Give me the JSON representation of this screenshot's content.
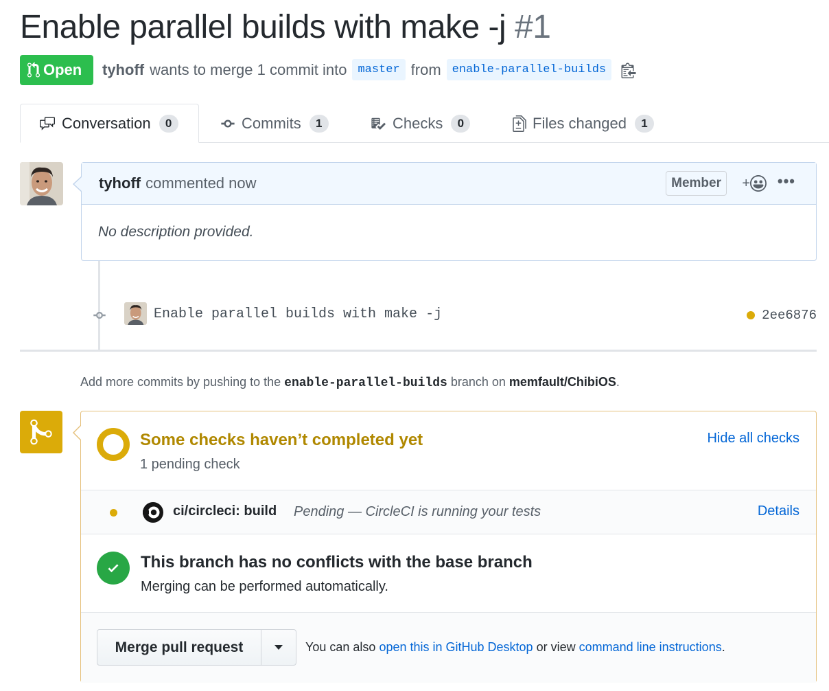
{
  "pr": {
    "title": "Enable parallel builds with make -j",
    "number": "#1",
    "state": "Open",
    "author": "tyhoff",
    "merge_text": "wants to merge 1 commit into",
    "base_branch": "master",
    "from_text": "from",
    "head_branch": "enable-parallel-builds"
  },
  "tabs": [
    {
      "label": "Conversation",
      "count": "0",
      "icon": "comment-discussion-icon"
    },
    {
      "label": "Commits",
      "count": "1",
      "icon": "git-commit-icon"
    },
    {
      "label": "Checks",
      "count": "0",
      "icon": "checklist-icon"
    },
    {
      "label": "Files changed",
      "count": "1",
      "icon": "diff-icon"
    }
  ],
  "comment": {
    "author": "tyhoff",
    "action": "commented now",
    "badge": "Member",
    "reaction_label": "+",
    "more_label": "•••",
    "body": "No description provided."
  },
  "commit": {
    "message": "Enable parallel builds with make -j",
    "sha": "2ee6876",
    "status_color": "#dbab09"
  },
  "hint": {
    "prefix": "Add more commits by pushing to the",
    "branch": "enable-parallel-builds",
    "middle": "branch on",
    "repo": "memfault/ChibiOS",
    "suffix": "."
  },
  "checks": {
    "heading": "Some checks haven’t completed yet",
    "subheading": "1 pending check",
    "hide_link": "Hide all checks",
    "items": [
      {
        "name": "ci/circleci: build",
        "description": "Pending — CircleCI is running your tests",
        "details": "Details"
      }
    ]
  },
  "conflicts": {
    "heading": "This branch has no conflicts with the base branch",
    "subheading": "Merging can be performed automatically."
  },
  "merge": {
    "button": "Merge pull request",
    "also_prefix": "You can also",
    "desktop_link": "open this in GitHub Desktop",
    "or_view": "or view",
    "cli_link": "command line instructions",
    "suffix": "."
  },
  "colors": {
    "open_green": "#2cbe4e",
    "pending_yellow": "#dbab09",
    "link_blue": "#0366d6",
    "success_green": "#28a745"
  }
}
